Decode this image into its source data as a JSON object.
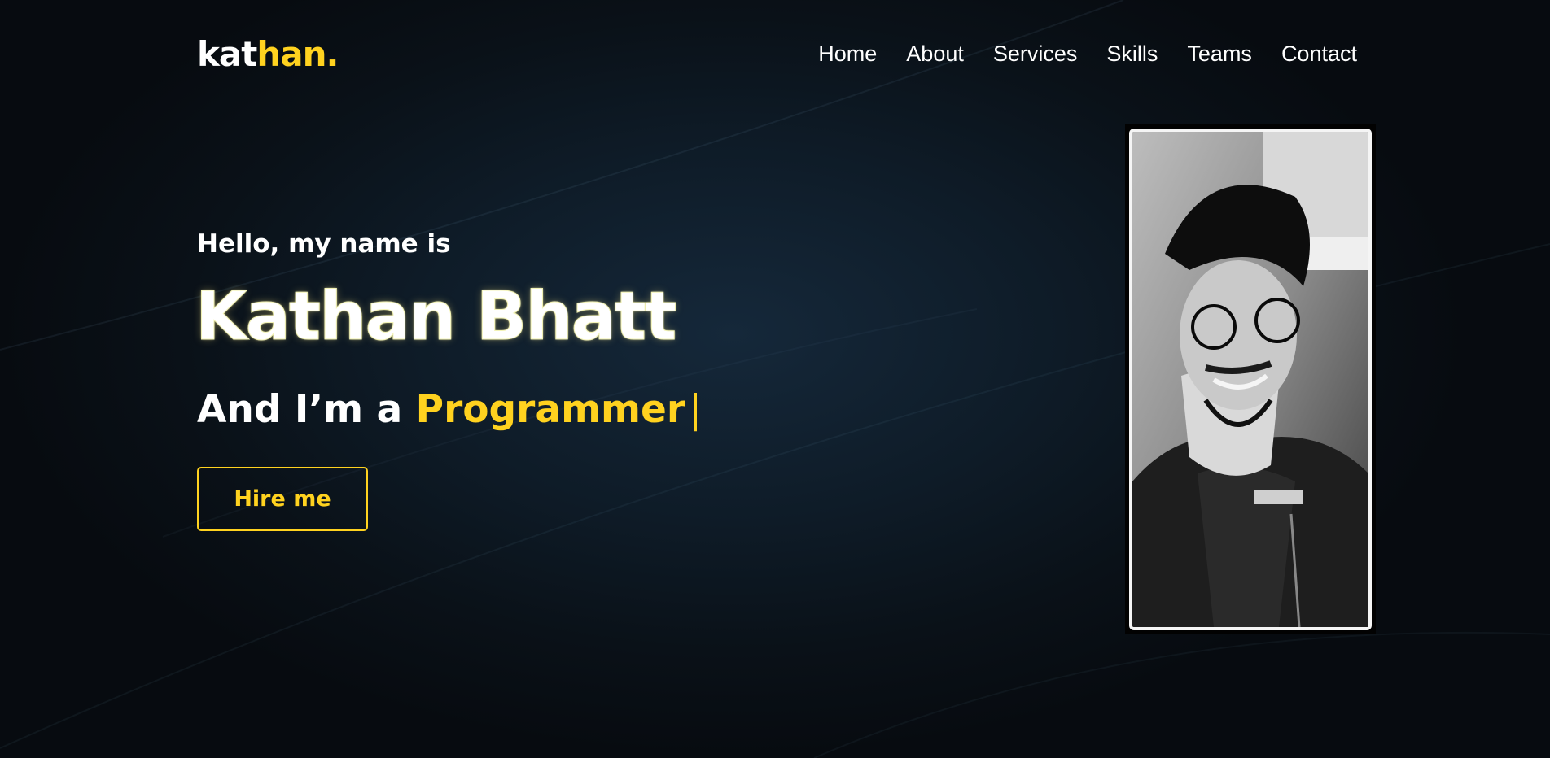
{
  "logo": {
    "part1": "kat",
    "part2": "han."
  },
  "nav": {
    "items": [
      {
        "label": "Home"
      },
      {
        "label": "About"
      },
      {
        "label": "Services"
      },
      {
        "label": "Skills"
      },
      {
        "label": "Teams"
      },
      {
        "label": "Contact"
      }
    ]
  },
  "hero": {
    "greeting": "Hello, my name is",
    "name": "Kathan Bhatt",
    "role_prefix": "And I’m a",
    "role_highlight": "Programmer",
    "cursor": "|",
    "hire_button": "Hire me"
  },
  "colors": {
    "accent": "#ffd21f",
    "background": "#0e1b27",
    "text": "#ffffff"
  }
}
